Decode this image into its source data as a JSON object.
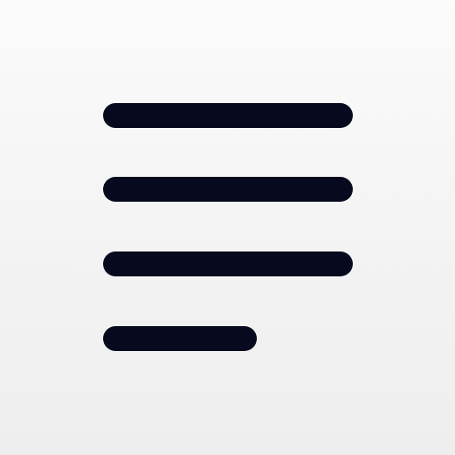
{
  "icon": {
    "name": "text-lines-icon",
    "line_color": "#070a1f",
    "background_color": "#f3f3f3"
  }
}
